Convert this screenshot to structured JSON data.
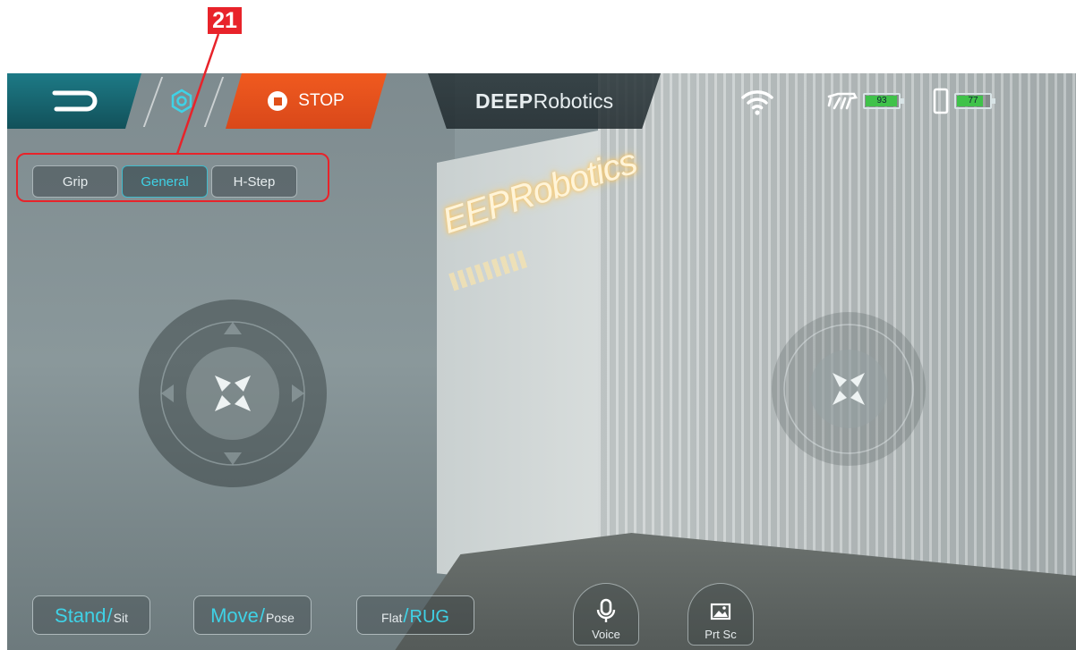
{
  "callout": {
    "number": "21"
  },
  "topbar": {
    "stop_label": "STOP",
    "brand_bold": "DEEP",
    "brand_rest": "Robotics",
    "robot_battery": "93",
    "phone_battery": "77",
    "robot_battery_level": 0.93,
    "phone_battery_level": 0.77,
    "battery_color": "#3fc24a"
  },
  "modes": {
    "items": [
      {
        "label": "Grip"
      },
      {
        "label": "General"
      },
      {
        "label": "H-Step"
      }
    ],
    "selected": "General"
  },
  "scene": {
    "sign_text": "EEPRobotics"
  },
  "bottom": {
    "stand": "Stand",
    "sit": "Sit",
    "move": "Move",
    "pose": "Pose",
    "flat": "Flat",
    "rug": "RUG",
    "voice": "Voice",
    "prtsc": "Prt Sc",
    "slash": "/"
  },
  "colors": {
    "accent": "#3fd2e6",
    "stop": "#e0501a",
    "callout": "#e8232a",
    "back": "#1d7a86"
  },
  "icons": [
    "back-icon",
    "settings-icon",
    "stop-icon",
    "wifi-icon",
    "robot-dog-icon",
    "phone-icon",
    "move-arrows-icon",
    "microphone-icon",
    "screenshot-icon"
  ]
}
